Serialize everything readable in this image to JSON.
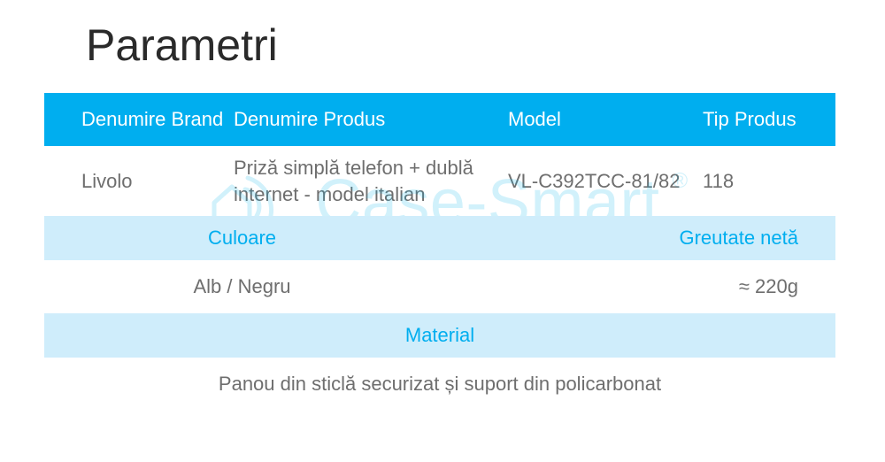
{
  "title": "Parametri",
  "watermark": "Case-Smart",
  "table": {
    "headers": {
      "brand": "Denumire Brand",
      "product": "Denumire Produs",
      "model": "Model",
      "type": "Tip Produs"
    },
    "row1": {
      "brand": "Livolo",
      "product": "Priză simplă telefon + dublă internet - model italian",
      "model": "VL-C392TCC-81/82",
      "type": "118"
    },
    "subheader2": {
      "color": "Culoare",
      "weight": "Greutate netă"
    },
    "row2": {
      "color": "Alb / Negru",
      "weight": "≈ 220g"
    },
    "subheader3": {
      "material": "Material"
    },
    "row3": {
      "material": "Panou din sticlă securizat și suport din policarbonat"
    }
  }
}
